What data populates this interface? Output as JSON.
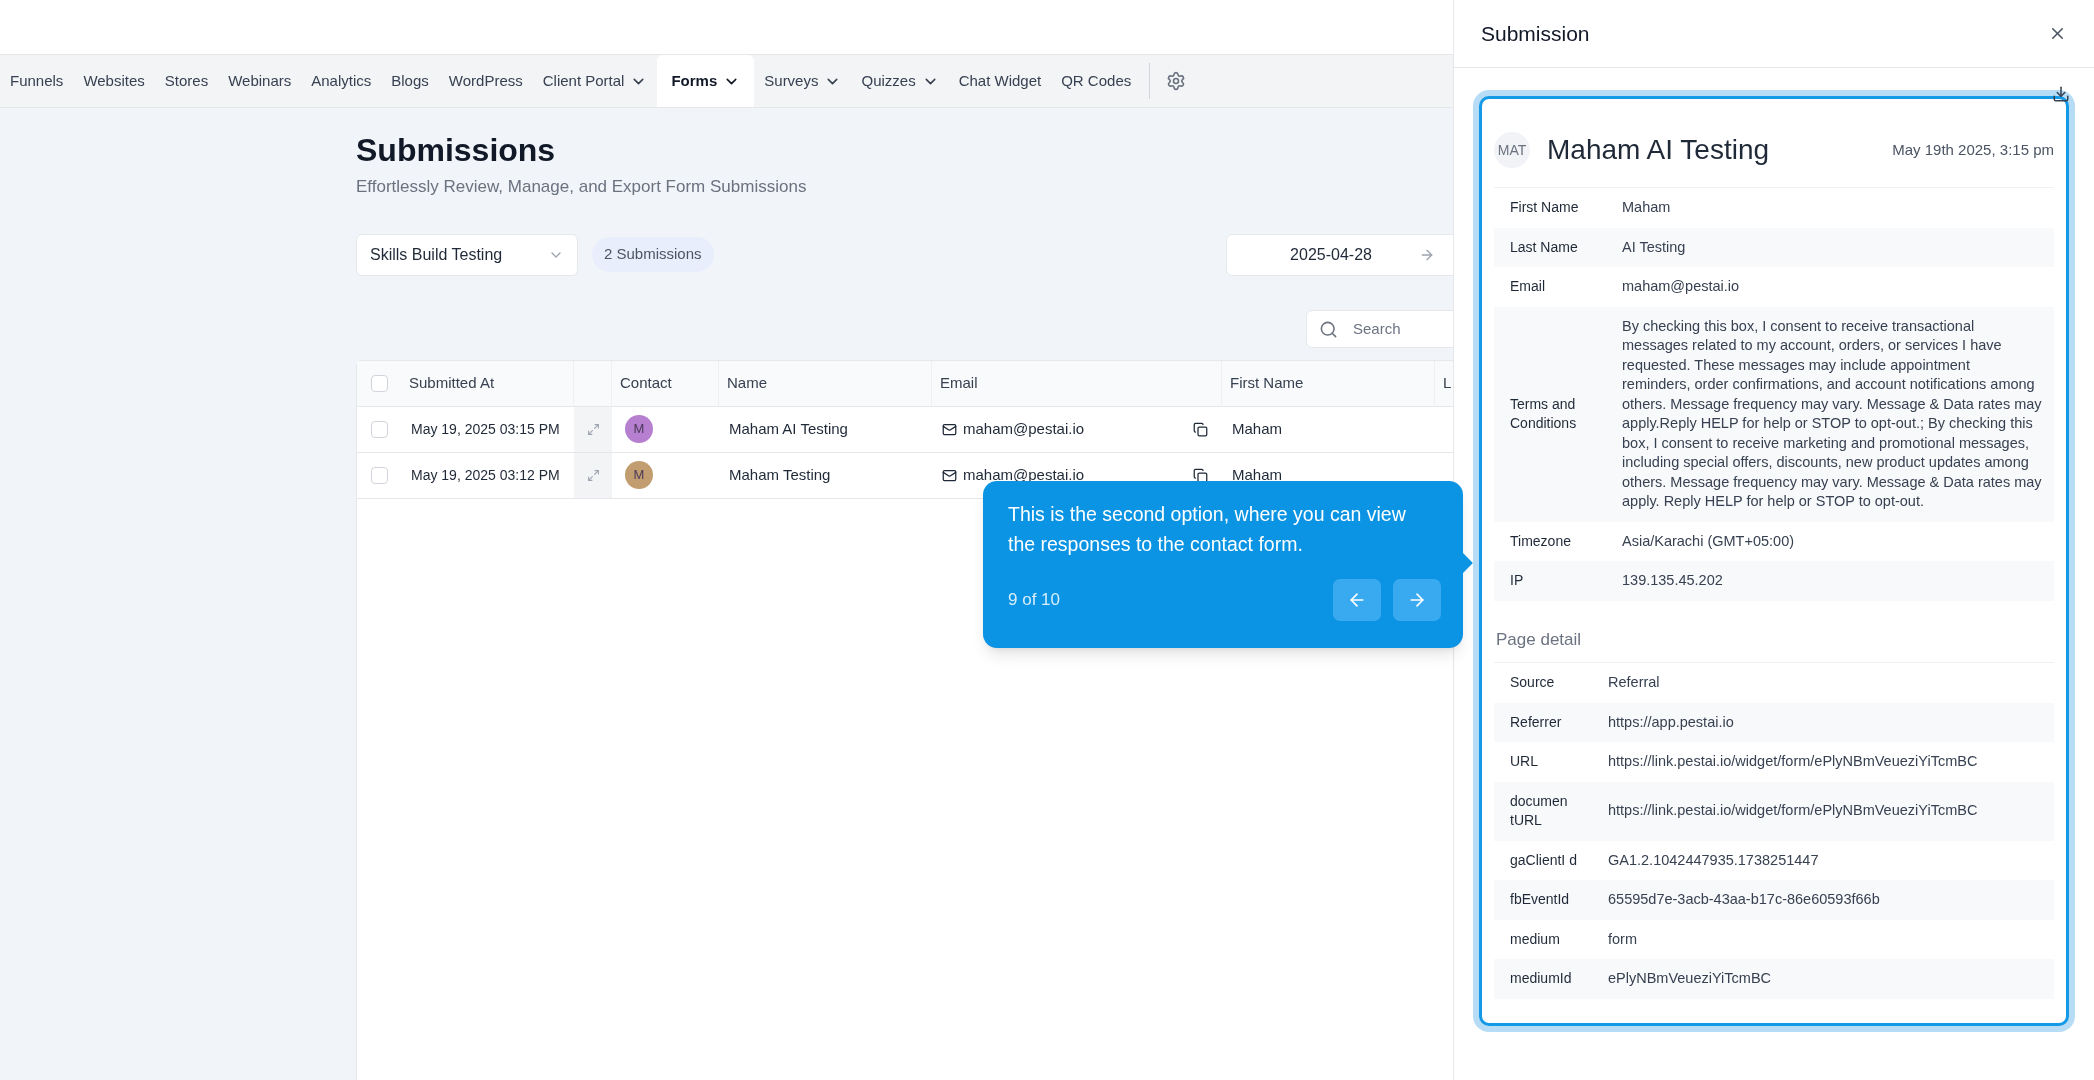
{
  "nav": {
    "items": [
      {
        "label": "Funnels",
        "dropdown": false,
        "selected": false
      },
      {
        "label": "Websites",
        "dropdown": false,
        "selected": false
      },
      {
        "label": "Stores",
        "dropdown": false,
        "selected": false
      },
      {
        "label": "Webinars",
        "dropdown": false,
        "selected": false
      },
      {
        "label": "Analytics",
        "dropdown": false,
        "selected": false
      },
      {
        "label": "Blogs",
        "dropdown": false,
        "selected": false
      },
      {
        "label": "WordPress",
        "dropdown": false,
        "selected": false
      },
      {
        "label": "Client Portal",
        "dropdown": true,
        "selected": false
      },
      {
        "label": "Forms",
        "dropdown": true,
        "selected": true
      },
      {
        "label": "Surveys",
        "dropdown": true,
        "selected": false
      },
      {
        "label": "Quizzes",
        "dropdown": true,
        "selected": false
      },
      {
        "label": "Chat Widget",
        "dropdown": false,
        "selected": false
      },
      {
        "label": "QR Codes",
        "dropdown": false,
        "selected": false
      }
    ]
  },
  "page": {
    "title": "Submissions",
    "subtitle": "Effortlessly Review, Manage, and Export Form Submissions",
    "form_select": {
      "value": "Skills Build Testing"
    },
    "count_badge": "2 Submissions",
    "date_field": {
      "value": "2025-04-28"
    },
    "search": {
      "placeholder": "Search"
    }
  },
  "table": {
    "header_checked": false,
    "columns": [
      "Submitted At",
      "Contact",
      "Name",
      "Email",
      "First Name",
      "L"
    ],
    "rows": [
      {
        "checked": false,
        "submitted_at": "May 19, 2025 03:15 PM",
        "contact": "M",
        "color": "#b77fcf",
        "name": "Maham AI Testing",
        "email": "maham@pestai.io",
        "first_name": "Maham"
      },
      {
        "checked": false,
        "submitted_at": "May 19, 2025 03:12 PM",
        "contact": "M",
        "color": "#c29d70",
        "name": "Maham Testing",
        "email": "maham@pestai.io",
        "first_name": "Maham"
      }
    ]
  },
  "tour": {
    "text": "This is the second option, where you can view the responses to the contact form.",
    "step": "9 of 10"
  },
  "drawer": {
    "title": "Submission",
    "card": {
      "initials": "MAT",
      "name": "Maham AI Testing",
      "date": "May 19th 2025, 3:15 pm",
      "fields": [
        {
          "label": "First Name",
          "value": "Maham"
        },
        {
          "label": "Last Name",
          "value": "AI Testing"
        },
        {
          "label": "Email",
          "value": "maham@pestai.io"
        },
        {
          "label": "Terms and Conditions",
          "value": "By checking this box, I consent to receive transactional messages related to my account, orders, or services I have requested. These messages may include appointment reminders, order confirmations, and account notifications among others. Message frequency may vary. Message & Data rates may apply.Reply HELP for help or STOP to opt-out.; By checking this box, I consent to receive marketing and promotional messages, including special offers, discounts, new product updates among others. Message frequency may vary. Message & Data rates may apply. Reply HELP for help or STOP to opt-out."
        },
        {
          "label": "Timezone",
          "value": "Asia/Karachi (GMT+05:00)"
        },
        {
          "label": "IP",
          "value": "139.135.45.202"
        }
      ],
      "page_detail_heading": "Page detail",
      "page_detail": [
        {
          "label": "Source",
          "value": "Referral"
        },
        {
          "label": "Referrer",
          "value": "https://app.pestai.io"
        },
        {
          "label": "URL",
          "value": "https://link.pestai.io/widget/form/ePlyNBmVeueziYiTcmBC"
        },
        {
          "label": "documen tURL",
          "value": "https://link.pestai.io/widget/form/ePlyNBmVeueziYiTcmBC"
        },
        {
          "label": "gaClientI d",
          "value": "GA1.2.1042447935.1738251447"
        },
        {
          "label": "fbEventId",
          "value": "65595d7e-3acb-43aa-b17c-86e60593f66b"
        },
        {
          "label": "medium",
          "value": "form"
        },
        {
          "label": "mediumId",
          "value": "ePlyNBmVeueziYiTcmBC"
        }
      ]
    }
  }
}
